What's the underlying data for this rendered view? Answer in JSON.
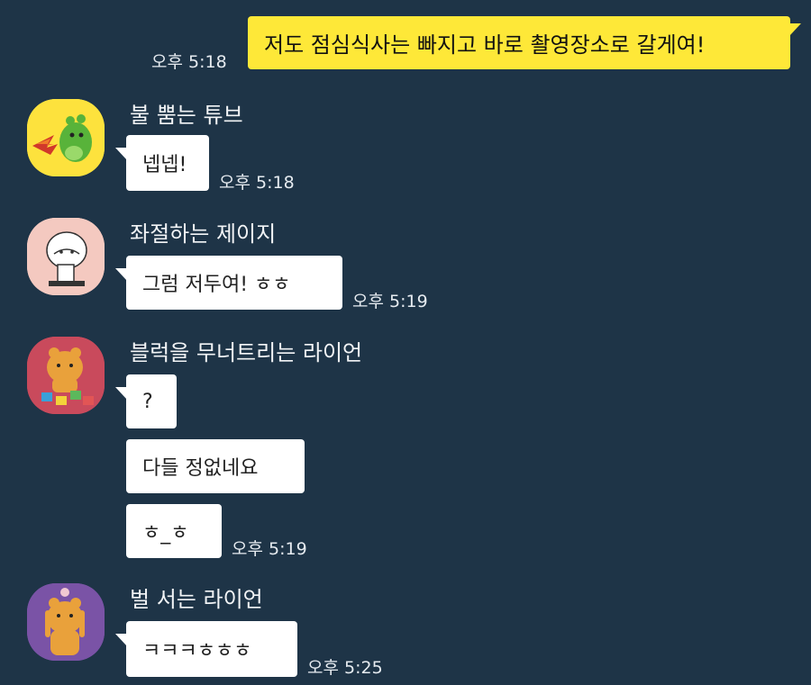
{
  "colors": {
    "background": "#1e3447",
    "my_bubble": "#fee838",
    "other_bubble": "#ffffff",
    "time_text": "#e6ebf0"
  },
  "messages": {
    "my_message": {
      "text": "저도 점심식사는 빠지고 바로 촬영장소로 갈게여!",
      "time": "오후 5:18"
    },
    "tube": {
      "sender": "불 뿜는 튜브",
      "avatar_icon": "fire-breathing-tube-icon",
      "text": "넵넵!",
      "time": "오후 5:18"
    },
    "jay_g": {
      "sender": "좌절하는 제이지",
      "avatar_icon": "frustrated-jay-g-icon",
      "text": "그럼 저두여! ㅎㅎ",
      "time": "오후 5:19"
    },
    "ryan_block": {
      "sender": "블럭을 무너트리는 라이언",
      "avatar_icon": "ryan-with-blocks-icon",
      "texts": [
        "?",
        "다들 정없네요",
        "ㅎ_ㅎ"
      ],
      "time": "오후 5:19"
    },
    "ryan_punish": {
      "sender": "벌 서는 라이언",
      "avatar_icon": "ryan-punished-icon",
      "text": "ㅋㅋㅋㅎㅎㅎ",
      "time": "오후 5:25"
    }
  }
}
